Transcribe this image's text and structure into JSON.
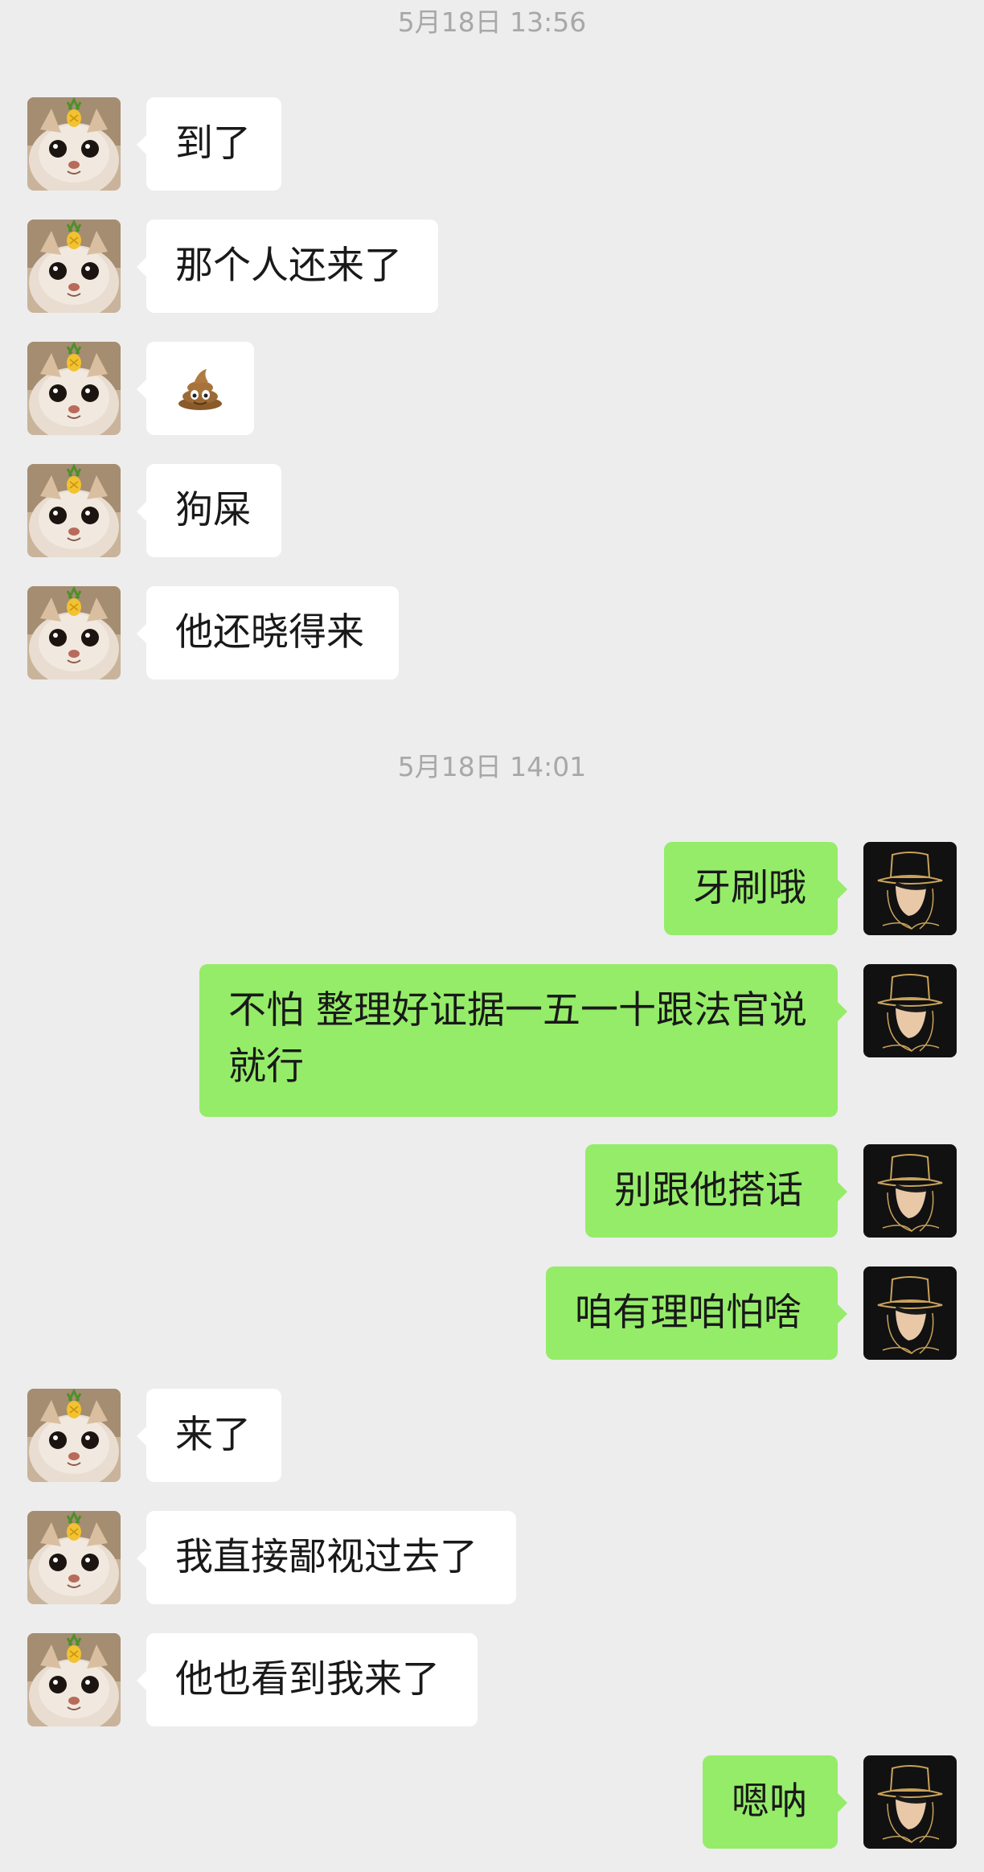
{
  "timestamps": [
    "5月18日 13:56",
    "5月18日 14:01"
  ],
  "messages": [
    {
      "side": "left",
      "text": "到了"
    },
    {
      "side": "left",
      "text": "那个人还来了"
    },
    {
      "side": "left",
      "text": "💩",
      "emoji": "poop-emoji"
    },
    {
      "side": "left",
      "text": "狗屎"
    },
    {
      "side": "left",
      "text": "他还晓得来"
    },
    {
      "side": "right",
      "text": "牙刷哦"
    },
    {
      "side": "right",
      "text": "不怕 整理好证据一五一十跟法官说就行"
    },
    {
      "side": "right",
      "text": "别跟他搭话"
    },
    {
      "side": "right",
      "text": "咱有理咱怕啥"
    },
    {
      "side": "left",
      "text": "来了"
    },
    {
      "side": "left",
      "text": "我直接鄙视过去了"
    },
    {
      "side": "left",
      "text": "他也看到我来了"
    },
    {
      "side": "right",
      "text": "嗯呐"
    }
  ],
  "colors": {
    "background": "#ededed",
    "received_bubble": "#ffffff",
    "sent_bubble": "#95ec69",
    "timestamp_text": "#a8a8a8",
    "message_text": "#191919"
  },
  "avatars": {
    "contact": "cat-with-pineapple-avatar-icon",
    "self": "man-in-top-hat-avatar-icon"
  }
}
